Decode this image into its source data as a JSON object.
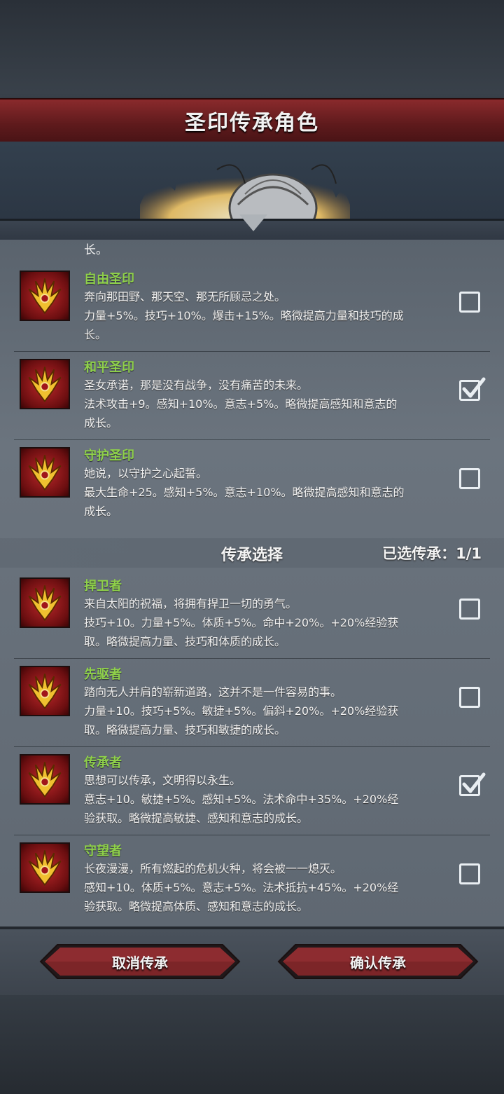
{
  "header": {
    "title": "圣印传承角色"
  },
  "list": {
    "cut_tail": "长。",
    "seals": [
      {
        "name": "自由圣印",
        "line1": "奔向那田野、那天空、那无所顾忌之处。",
        "line2": "力量+5%。技巧+10%。爆击+15%。略微提高力量和技巧的成",
        "line3": "长。",
        "checked": false
      },
      {
        "name": "和平圣印",
        "line1": "圣女承诺，那是没有战争，没有痛苦的未来。",
        "line2": "法术攻击+9。感知+10%。意志+5%。略微提高感知和意志的",
        "line3": "成长。",
        "checked": true
      },
      {
        "name": "守护圣印",
        "line1": "她说，以守护之心起誓。",
        "line2": "最大生命+25。感知+5%。意志+10%。略微提高感知和意志的",
        "line3": "成长。",
        "checked": false
      }
    ],
    "section": {
      "title": "传承选择",
      "count": "已选传承：1/1"
    },
    "legacies": [
      {
        "name": "捍卫者",
        "line1": "来自太阳的祝福，将拥有捍卫一切的勇气。",
        "line2": "技巧+10。力量+5%。体质+5%。命中+20%。+20%经验获",
        "line3": "取。略微提高力量、技巧和体质的成长。",
        "checked": false
      },
      {
        "name": "先驱者",
        "line1": "踏向无人并肩的崭新道路，这并不是一件容易的事。",
        "line2": "力量+10。技巧+5%。敏捷+5%。偏斜+20%。+20%经验获",
        "line3": "取。略微提高力量、技巧和敏捷的成长。",
        "checked": false
      },
      {
        "name": "传承者",
        "line1": "思想可以传承，文明得以永生。",
        "line2": "意志+10。敏捷+5%。感知+5%。法术命中+35%。+20%经",
        "line3": "验获取。略微提高敏捷、感知和意志的成长。",
        "checked": true
      },
      {
        "name": "守望者",
        "line1": "长夜漫漫，所有燃起的危机火种，将会被一一熄灭。",
        "line2": "感知+10。体质+5%。意志+5%。法术抵抗+45%。+20%经",
        "line3": "验获取。略微提高体质、感知和意志的成长。",
        "checked": false
      }
    ]
  },
  "buttons": {
    "cancel": "取消传承",
    "confirm": "确认传承"
  },
  "colors": {
    "name_green": "#8fd14a",
    "banner_red": "#7a2426",
    "emblem_gold": "#f0c030"
  }
}
